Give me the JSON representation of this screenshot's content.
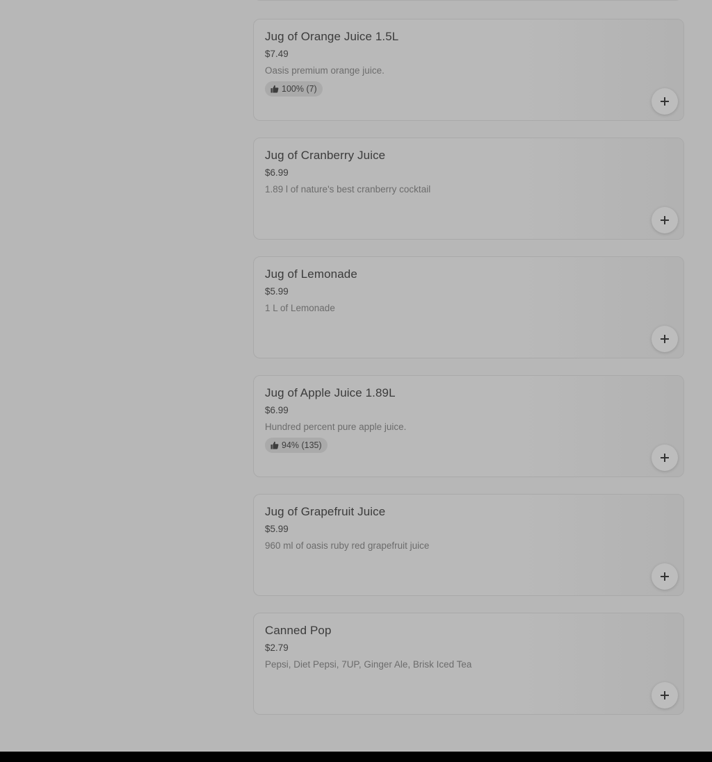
{
  "colors": {
    "overlay_bg": "#b7b7b7",
    "card_border": "#a9a9a9",
    "title_text": "#3b3b3b",
    "desc_text": "#6c6c6c",
    "footer_bar": "#000000"
  },
  "items": [
    {
      "name": "Jug of Orange Juice 1.5L",
      "price": "$7.49",
      "description": "Oasis premium orange juice.",
      "rating": "100% (7)",
      "icon": "plus-icon"
    },
    {
      "name": "Jug of Cranberry Juice",
      "price": "$6.99",
      "description": "1.89 l of nature's best cranberry cocktail",
      "rating": null,
      "icon": "plus-icon"
    },
    {
      "name": "Jug of Lemonade",
      "price": "$5.99",
      "description": "1 L of Lemonade",
      "rating": null,
      "icon": "plus-icon"
    },
    {
      "name": "Jug of Apple Juice 1.89L",
      "price": "$6.99",
      "description": "Hundred percent pure apple juice.",
      "rating": "94% (135)",
      "icon": "plus-icon"
    },
    {
      "name": "Jug of Grapefruit Juice",
      "price": "$5.99",
      "description": "960 ml of oasis ruby red grapefruit juice",
      "rating": null,
      "icon": "plus-icon"
    },
    {
      "name": "Canned Pop",
      "price": "$2.79",
      "description": "Pepsi, Diet Pepsi, 7UP, Ginger Ale, Brisk Iced Tea",
      "rating": null,
      "icon": "plus-icon"
    }
  ]
}
